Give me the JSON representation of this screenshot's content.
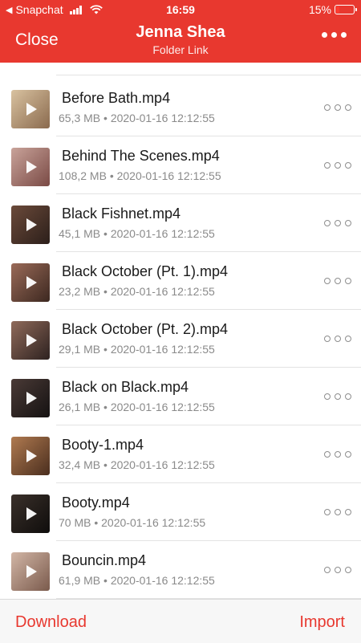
{
  "status_bar": {
    "back_app": "Snapchat",
    "time": "16:59",
    "battery": "15%"
  },
  "header": {
    "close_label": "Close",
    "title": "Jenna Shea",
    "subtitle": "Folder Link"
  },
  "files": [
    {
      "name": "Before Bath.mp4",
      "meta": "65,3 MB • 2020-01-16 12:12:55",
      "thumb_colors": [
        "#d9c2a0",
        "#8a6a4e"
      ]
    },
    {
      "name": "Behind The Scenes.mp4",
      "meta": "108,2 MB • 2020-01-16 12:12:55",
      "thumb_colors": [
        "#c9a39a",
        "#7a4a45"
      ]
    },
    {
      "name": "Black Fishnet.mp4",
      "meta": "45,1 MB • 2020-01-16 12:12:55",
      "thumb_colors": [
        "#6b4a3a",
        "#2c1f1a"
      ]
    },
    {
      "name": "Black October (Pt. 1).mp4",
      "meta": "23,2 MB • 2020-01-16 12:12:55",
      "thumb_colors": [
        "#9a6a58",
        "#3c2820"
      ]
    },
    {
      "name": "Black October (Pt. 2).mp4",
      "meta": "29,1 MB • 2020-01-16 12:12:55",
      "thumb_colors": [
        "#8f6a5a",
        "#2e2220"
      ]
    },
    {
      "name": "Black on Black.mp4",
      "meta": "26,1 MB • 2020-01-16 12:12:55",
      "thumb_colors": [
        "#4a3a36",
        "#151212"
      ]
    },
    {
      "name": "Booty-1.mp4",
      "meta": "32,4 MB • 2020-01-16 12:12:55",
      "thumb_colors": [
        "#b07a50",
        "#4a2e1e"
      ]
    },
    {
      "name": "Booty.mp4",
      "meta": "70 MB • 2020-01-16 12:12:55",
      "thumb_colors": [
        "#3a302a",
        "#0f0d0c"
      ]
    },
    {
      "name": "Bouncin.mp4",
      "meta": "61,9 MB • 2020-01-16 12:12:55",
      "thumb_colors": [
        "#d2b6a6",
        "#7a5a4c"
      ]
    }
  ],
  "footer": {
    "download_label": "Download",
    "import_label": "Import"
  },
  "colors": {
    "accent": "#e8382f",
    "footer_bg": "#f7f7f7"
  }
}
